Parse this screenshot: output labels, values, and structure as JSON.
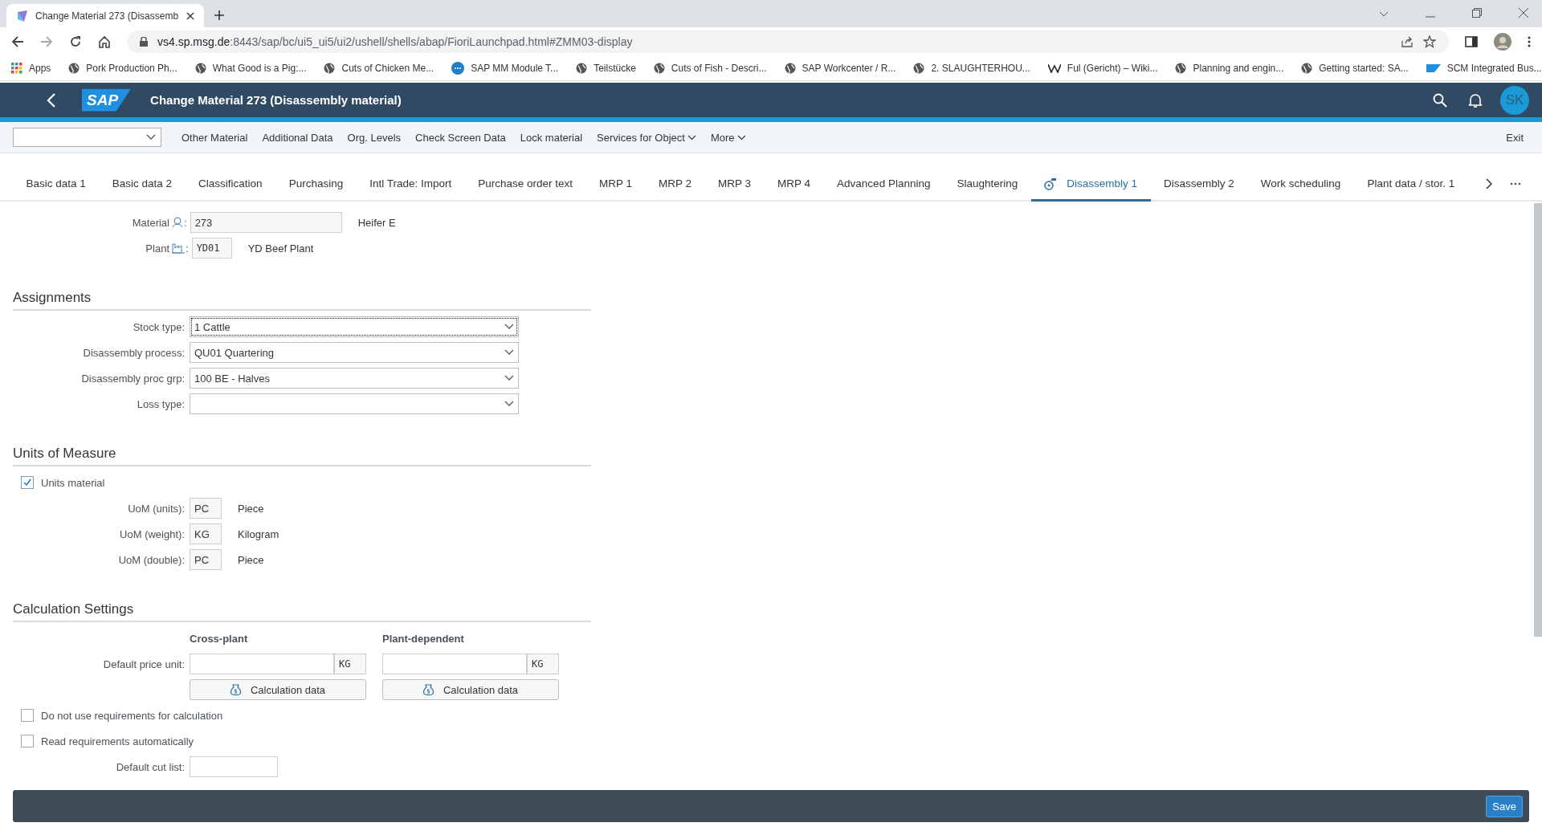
{
  "browser": {
    "tab_title": "Change Material 273 (Disassemb",
    "url": {
      "host": "vs4.sp.msg.de",
      "path": ":8443/sap/bc/ui5_ui5/ui2/ushell/shells/abap/FioriLaunchpad.html#ZMM03-display"
    },
    "bookmarks": [
      {
        "kind": "apps",
        "label": "Apps"
      },
      {
        "kind": "globe",
        "label": "Pork Production Ph..."
      },
      {
        "kind": "globe",
        "label": "What Good is a Pig:..."
      },
      {
        "kind": "globe",
        "label": "Cuts of Chicken Me..."
      },
      {
        "kind": "sap",
        "label": "SAP MM Module T..."
      },
      {
        "kind": "globe",
        "label": "Teilstücke"
      },
      {
        "kind": "globe",
        "label": "Cuts of Fish - Descri..."
      },
      {
        "kind": "globe",
        "label": "SAP Workcenter / R..."
      },
      {
        "kind": "globe",
        "label": "2. SLAUGHTERHOU..."
      },
      {
        "kind": "wiki",
        "label": "Ful (Gericht) – Wiki..."
      },
      {
        "kind": "globe",
        "label": "Planning and engin..."
      },
      {
        "kind": "globe",
        "label": "Getting started: SA..."
      },
      {
        "kind": "sapflag",
        "label": "SCM Integrated Bus..."
      }
    ]
  },
  "header": {
    "logo": "SAP",
    "title": "Change Material 273 (Disassembly material)",
    "avatar": "SK"
  },
  "toolbar": {
    "items": [
      {
        "kind": "button",
        "label": "Other Material"
      },
      {
        "kind": "button",
        "label": "Additional Data"
      },
      {
        "kind": "button",
        "label": "Org. Levels"
      },
      {
        "kind": "button",
        "label": "Check Screen Data"
      },
      {
        "kind": "button",
        "label": "Lock material"
      },
      {
        "kind": "menu",
        "label": "Services for Object"
      },
      {
        "kind": "menu",
        "label": "More"
      }
    ],
    "exit": "Exit"
  },
  "tabs": [
    {
      "label": "Basic data 1",
      "selected": false,
      "icon": false
    },
    {
      "label": "Basic data 2",
      "selected": false,
      "icon": false
    },
    {
      "label": "Classification",
      "selected": false,
      "icon": false
    },
    {
      "label": "Purchasing",
      "selected": false,
      "icon": false
    },
    {
      "label": "Intl Trade: Import",
      "selected": false,
      "icon": false
    },
    {
      "label": "Purchase order text",
      "selected": false,
      "icon": false
    },
    {
      "label": "MRP 1",
      "selected": false,
      "icon": false
    },
    {
      "label": "MRP 2",
      "selected": false,
      "icon": false
    },
    {
      "label": "MRP 3",
      "selected": false,
      "icon": false
    },
    {
      "label": "MRP 4",
      "selected": false,
      "icon": false
    },
    {
      "label": "Advanced Planning",
      "selected": false,
      "icon": false
    },
    {
      "label": "Slaughtering",
      "selected": false,
      "icon": false
    },
    {
      "label": "Disassembly 1",
      "selected": true,
      "icon": true
    },
    {
      "label": "Disassembly 2",
      "selected": false,
      "icon": false
    },
    {
      "label": "Work scheduling",
      "selected": false,
      "icon": false
    },
    {
      "label": "Plant data / stor. 1",
      "selected": false,
      "icon": false
    }
  ],
  "material": {
    "label": "Material",
    "colon": ":",
    "value": "273",
    "description": "Heifer E"
  },
  "plant": {
    "label": "Plant",
    "colon": ":",
    "value": "YD01",
    "description": "YD Beef Plant"
  },
  "assignments": {
    "title": "Assignments",
    "fields": [
      {
        "label": "Stock type:",
        "value": "1 Cattle",
        "focused": true
      },
      {
        "label": "Disassembly process:",
        "value": "QU01 Quartering",
        "focused": false
      },
      {
        "label": "Disassembly proc grp:",
        "value": "100 BE - Halves",
        "focused": false
      },
      {
        "label": "Loss type:",
        "focused": false
      }
    ]
  },
  "units": {
    "title": "Units of Measure",
    "checkbox": {
      "label": "Units material",
      "checked": true
    },
    "rows": [
      {
        "label": "UoM (units):",
        "value": "PC",
        "description": "Piece"
      },
      {
        "label": "UoM (weight):",
        "value": "KG",
        "description": "Kilogram"
      },
      {
        "label": "UoM (double):",
        "value": "PC",
        "description": "Piece"
      }
    ]
  },
  "calculation": {
    "title": "Calculation Settings",
    "columns": [
      {
        "heading": "Cross-plant",
        "unit": "KG",
        "button": "Calculation data"
      },
      {
        "heading": "Plant-dependent",
        "unit": "KG",
        "button": "Calculation data"
      }
    ],
    "price_label": "Default price unit:",
    "checkboxes": [
      {
        "label": "Do not use requirements for calculation",
        "checked": false
      },
      {
        "label": "Read requirements automatically",
        "checked": false
      }
    ],
    "cut_list_label": "Default cut list:"
  },
  "footer": {
    "save": "Save"
  }
}
